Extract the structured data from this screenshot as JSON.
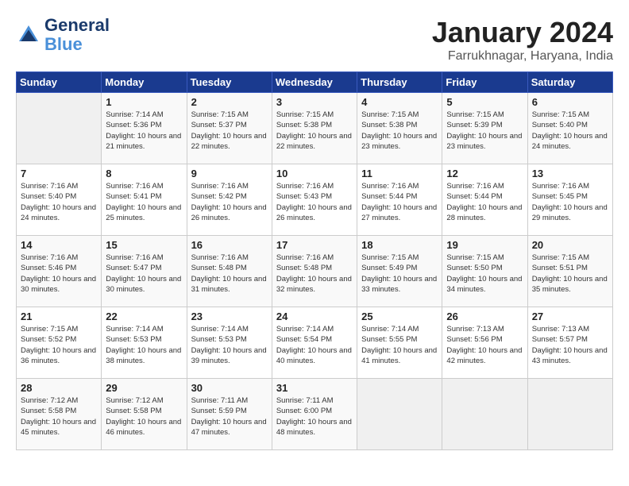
{
  "logo": {
    "line1": "General",
    "line2": "Blue"
  },
  "title": "January 2024",
  "location": "Farrukhnagar, Haryana, India",
  "headers": [
    "Sunday",
    "Monday",
    "Tuesday",
    "Wednesday",
    "Thursday",
    "Friday",
    "Saturday"
  ],
  "weeks": [
    [
      null,
      {
        "day": "1",
        "sunrise": "7:14 AM",
        "sunset": "5:36 PM",
        "daylight": "10 hours and 21 minutes."
      },
      {
        "day": "2",
        "sunrise": "7:15 AM",
        "sunset": "5:37 PM",
        "daylight": "10 hours and 22 minutes."
      },
      {
        "day": "3",
        "sunrise": "7:15 AM",
        "sunset": "5:38 PM",
        "daylight": "10 hours and 22 minutes."
      },
      {
        "day": "4",
        "sunrise": "7:15 AM",
        "sunset": "5:38 PM",
        "daylight": "10 hours and 23 minutes."
      },
      {
        "day": "5",
        "sunrise": "7:15 AM",
        "sunset": "5:39 PM",
        "daylight": "10 hours and 23 minutes."
      },
      {
        "day": "6",
        "sunrise": "7:15 AM",
        "sunset": "5:40 PM",
        "daylight": "10 hours and 24 minutes."
      }
    ],
    [
      {
        "day": "7",
        "sunrise": "7:16 AM",
        "sunset": "5:40 PM",
        "daylight": "10 hours and 24 minutes."
      },
      {
        "day": "8",
        "sunrise": "7:16 AM",
        "sunset": "5:41 PM",
        "daylight": "10 hours and 25 minutes."
      },
      {
        "day": "9",
        "sunrise": "7:16 AM",
        "sunset": "5:42 PM",
        "daylight": "10 hours and 26 minutes."
      },
      {
        "day": "10",
        "sunrise": "7:16 AM",
        "sunset": "5:43 PM",
        "daylight": "10 hours and 26 minutes."
      },
      {
        "day": "11",
        "sunrise": "7:16 AM",
        "sunset": "5:44 PM",
        "daylight": "10 hours and 27 minutes."
      },
      {
        "day": "12",
        "sunrise": "7:16 AM",
        "sunset": "5:44 PM",
        "daylight": "10 hours and 28 minutes."
      },
      {
        "day": "13",
        "sunrise": "7:16 AM",
        "sunset": "5:45 PM",
        "daylight": "10 hours and 29 minutes."
      }
    ],
    [
      {
        "day": "14",
        "sunrise": "7:16 AM",
        "sunset": "5:46 PM",
        "daylight": "10 hours and 30 minutes."
      },
      {
        "day": "15",
        "sunrise": "7:16 AM",
        "sunset": "5:47 PM",
        "daylight": "10 hours and 30 minutes."
      },
      {
        "day": "16",
        "sunrise": "7:16 AM",
        "sunset": "5:48 PM",
        "daylight": "10 hours and 31 minutes."
      },
      {
        "day": "17",
        "sunrise": "7:16 AM",
        "sunset": "5:48 PM",
        "daylight": "10 hours and 32 minutes."
      },
      {
        "day": "18",
        "sunrise": "7:15 AM",
        "sunset": "5:49 PM",
        "daylight": "10 hours and 33 minutes."
      },
      {
        "day": "19",
        "sunrise": "7:15 AM",
        "sunset": "5:50 PM",
        "daylight": "10 hours and 34 minutes."
      },
      {
        "day": "20",
        "sunrise": "7:15 AM",
        "sunset": "5:51 PM",
        "daylight": "10 hours and 35 minutes."
      }
    ],
    [
      {
        "day": "21",
        "sunrise": "7:15 AM",
        "sunset": "5:52 PM",
        "daylight": "10 hours and 36 minutes."
      },
      {
        "day": "22",
        "sunrise": "7:14 AM",
        "sunset": "5:53 PM",
        "daylight": "10 hours and 38 minutes."
      },
      {
        "day": "23",
        "sunrise": "7:14 AM",
        "sunset": "5:53 PM",
        "daylight": "10 hours and 39 minutes."
      },
      {
        "day": "24",
        "sunrise": "7:14 AM",
        "sunset": "5:54 PM",
        "daylight": "10 hours and 40 minutes."
      },
      {
        "day": "25",
        "sunrise": "7:14 AM",
        "sunset": "5:55 PM",
        "daylight": "10 hours and 41 minutes."
      },
      {
        "day": "26",
        "sunrise": "7:13 AM",
        "sunset": "5:56 PM",
        "daylight": "10 hours and 42 minutes."
      },
      {
        "day": "27",
        "sunrise": "7:13 AM",
        "sunset": "5:57 PM",
        "daylight": "10 hours and 43 minutes."
      }
    ],
    [
      {
        "day": "28",
        "sunrise": "7:12 AM",
        "sunset": "5:58 PM",
        "daylight": "10 hours and 45 minutes."
      },
      {
        "day": "29",
        "sunrise": "7:12 AM",
        "sunset": "5:58 PM",
        "daylight": "10 hours and 46 minutes."
      },
      {
        "day": "30",
        "sunrise": "7:11 AM",
        "sunset": "5:59 PM",
        "daylight": "10 hours and 47 minutes."
      },
      {
        "day": "31",
        "sunrise": "7:11 AM",
        "sunset": "6:00 PM",
        "daylight": "10 hours and 48 minutes."
      },
      null,
      null,
      null
    ]
  ]
}
